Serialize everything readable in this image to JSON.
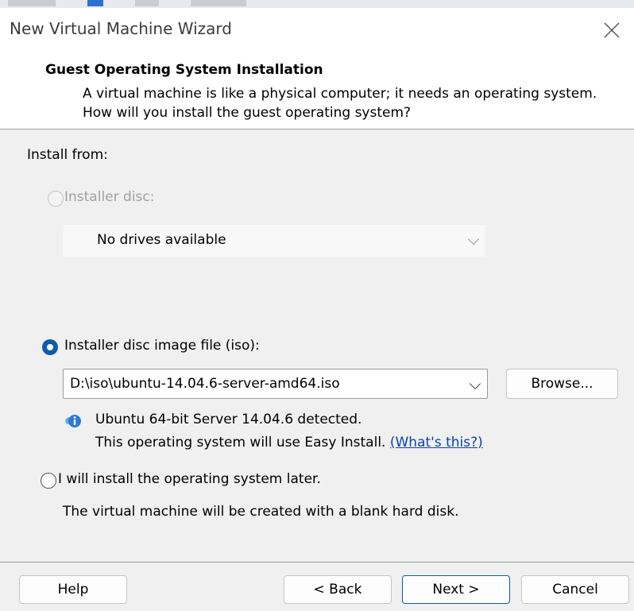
{
  "window": {
    "title": "New Virtual Machine Wizard"
  },
  "header": {
    "title": "Guest Operating System Installation",
    "description": "A virtual machine is like a physical computer; it needs an operating system. How will you install the guest operating system?"
  },
  "install": {
    "label": "Install from:",
    "disc": {
      "label": "Installer disc:",
      "selected": false,
      "enabled": false,
      "drive_value": "No drives available"
    },
    "iso": {
      "label": "Installer disc image file (iso):",
      "selected": true,
      "path": "D:\\iso\\ubuntu-14.04.6-server-amd64.iso",
      "browse_label": "Browse...",
      "detected_text": "Ubuntu 64-bit Server 14.04.6 detected.",
      "easy_install_text": "This operating system will use Easy Install.",
      "whats_this_link": "(What's this?)"
    },
    "later": {
      "label": "I will install the operating system later.",
      "selected": false,
      "description": "The virtual machine will be created with a blank hard disk."
    }
  },
  "footer": {
    "help_label": "Help",
    "back_label": "< Back",
    "next_label": "Next >",
    "cancel_label": "Cancel"
  },
  "colors": {
    "accent": "#0b5cad",
    "link": "#0645ad",
    "panel_bg": "#f0f0f0"
  },
  "icons": {
    "close": "close-icon",
    "info": "info-icon",
    "dropdown": "chevron-down-icon"
  }
}
